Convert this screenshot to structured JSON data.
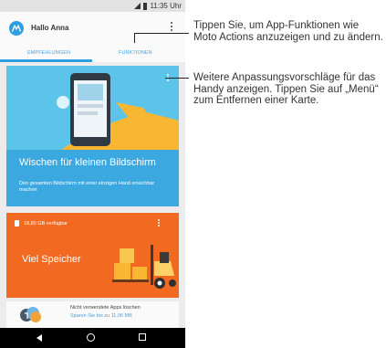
{
  "status_bar": {
    "time": "11:35 Uhr",
    "icons": [
      "signal-icon",
      "battery-icon"
    ]
  },
  "app_bar": {
    "greeting": "Hallo Anna",
    "logo_icon": "moto-logo-icon",
    "menu_icon": "overflow-menu-icon",
    "tabs": [
      {
        "label": "EMPFEHLUNGEN",
        "selected": true
      },
      {
        "label": "FUNKTIONEN",
        "selected": false
      }
    ]
  },
  "cards": {
    "swipe": {
      "title": "Wischen für kleinen Bildschirm",
      "subtitle": "Den gesamten Bildschirm mit einer einzigen Hand erreichbar machen",
      "color": "#3ba8e0"
    },
    "storage": {
      "available": "18,80 GB verfügbar",
      "title": "Viel Speicher",
      "color": "#f26a21"
    },
    "unused_apps": {
      "title": "Nicht verwendete Apps löschen",
      "subtitle": "Sparen Sie bis zu 11,96 MB"
    }
  },
  "nav_bar": {
    "icons": [
      "back-icon",
      "home-icon",
      "recent-apps-icon"
    ]
  },
  "callouts": [
    {
      "text": "Tippen Sie, um App-Funktionen wie Moto Actions anzuzeigen und zu ändern."
    },
    {
      "text": "Weitere Anpassungsvorschläge für das Handy anzeigen. Tippen Sie auf „Menü“ zum Entfernen einer Karte."
    }
  ],
  "colors": {
    "accent": "#2d9fe0",
    "tab_text": "#4aa3df",
    "background": "#ececec"
  }
}
